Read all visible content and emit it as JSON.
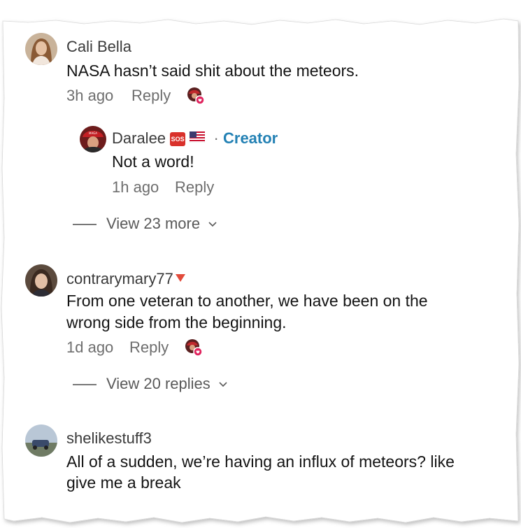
{
  "comments": [
    {
      "username": "Cali Bella",
      "text": "NASA hasn’t said shit about the meteors.",
      "time": "3h ago",
      "reply_label": "Reply",
      "icon": "creator-liked-icon",
      "replies": [
        {
          "username": "Daralee",
          "badges": [
            "sos-emoji",
            "us-flag-emoji"
          ],
          "sos_text": "SOS",
          "role": "Creator",
          "text": "Not a word!",
          "time": "1h ago",
          "reply_label": "Reply"
        }
      ],
      "view_more_label": "View 23 more"
    },
    {
      "username": "contrarymary77",
      "text_lines": [
        "From one veteran to another, we have been on the",
        "wrong side from the beginning."
      ],
      "time": "1d ago",
      "reply_label": "Reply",
      "icon": "creator-liked-icon",
      "view_more_label": "View 20 replies"
    },
    {
      "username": "shelikestuff3",
      "text_lines": [
        "All of a sudden, we’re having an influx of meteors? like",
        "give me a break"
      ]
    }
  ],
  "colors": {
    "creator": "#2381b4",
    "meta": "#6e6e6e",
    "like_badge": "#e0245e"
  }
}
